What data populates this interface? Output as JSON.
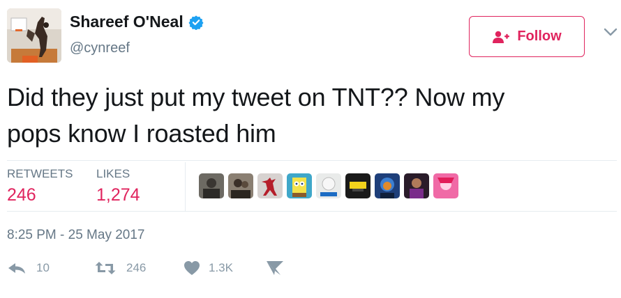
{
  "user": {
    "name": "Shareef O'Neal",
    "handle": "@cynreef",
    "verified_icon": "verified-badge-icon",
    "avatar_icon": "basketball-player-avatar"
  },
  "follow": {
    "label": "Follow",
    "icon": "add-user-icon",
    "color": "#e0245e"
  },
  "menu": {
    "icon": "chevron-down-icon"
  },
  "tweet": {
    "line1": "Did they just put my tweet on TNT?? Now my",
    "line2": "pops know I roasted him"
  },
  "stats": {
    "retweets_label": "RETWEETS",
    "retweets_value": "246",
    "likes_label": "LIKES",
    "likes_value": "1,274"
  },
  "likers": [
    {
      "icon": "liker-avatar-1",
      "color": "#6d6a63"
    },
    {
      "icon": "liker-avatar-2",
      "color": "#8a7f72"
    },
    {
      "icon": "liker-avatar-jumpman",
      "color": "#c9c4c2"
    },
    {
      "icon": "liker-avatar-spongebob",
      "color": "#3fa7c9"
    },
    {
      "icon": "liker-avatar-5",
      "color": "#e9ebea"
    },
    {
      "icon": "liker-avatar-6",
      "color": "#1a1a1a"
    },
    {
      "icon": "liker-avatar-7",
      "color": "#1e3f7a"
    },
    {
      "icon": "liker-avatar-8",
      "color": "#2a1c2a"
    },
    {
      "icon": "liker-avatar-9",
      "color": "#f06aa6"
    }
  ],
  "timestamp": "8:25 PM - 25 May 2017",
  "actions": {
    "reply_count": "10",
    "retweet_count": "246",
    "like_count": "1.3K",
    "reply_icon": "reply-icon",
    "retweet_icon": "retweet-icon",
    "like_icon": "heart-icon",
    "dm_icon": "direct-message-icon"
  }
}
